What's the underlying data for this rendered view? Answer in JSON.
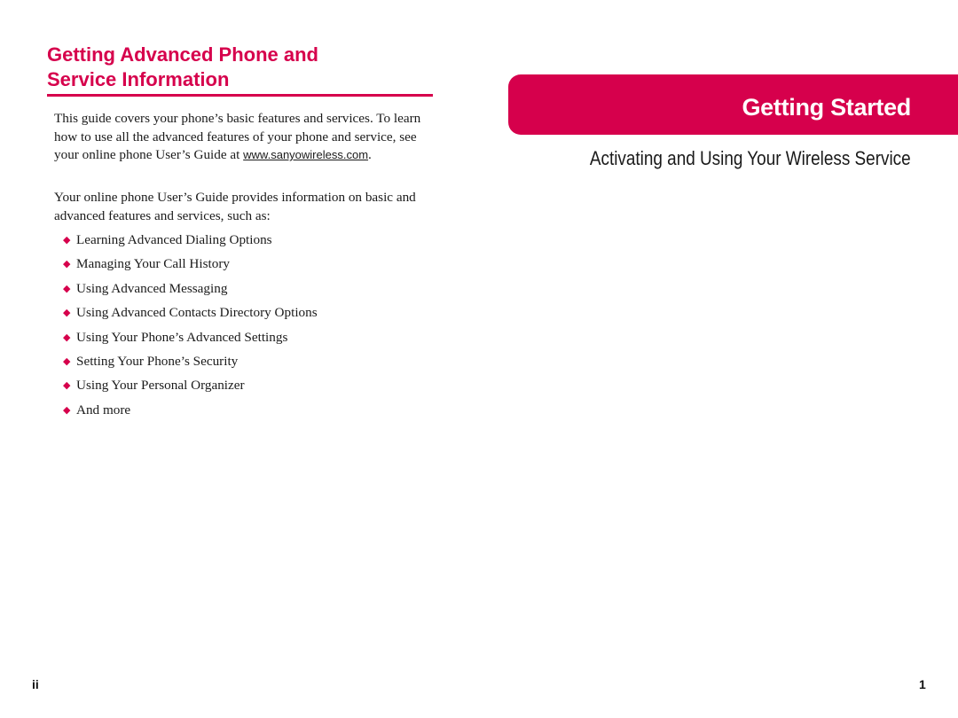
{
  "left_page": {
    "heading_line1": "Getting Advanced Phone and",
    "heading_line2": "Service Information",
    "paragraph1_text": "This guide covers your phone’s basic features and services. To learn how to use all the advanced features of your phone and service, see your online phone User’s Guide at ",
    "paragraph1_link": "www.sanyowireless.com",
    "paragraph1_end": ".",
    "paragraph2": "Your online phone User’s Guide provides information on basic and advanced features and services, such as:",
    "bullet_icon": "diamond-icon",
    "bullets": [
      "Learning Advanced Dialing Options",
      "Managing Your Call History",
      "Using Advanced Messaging",
      "Using Advanced Contacts Directory Options",
      "Using Your Phone’s Advanced Settings",
      "Setting Your Phone’s Security",
      "Using Your Personal Organizer",
      "And more"
    ],
    "page_number": "ii"
  },
  "right_page": {
    "banner_title": "Getting Started",
    "subtitle": "Activating and Using Your Wireless Service",
    "page_number": "1"
  },
  "colors": {
    "accent": "#d6004c",
    "text": "#1a1a1a"
  }
}
